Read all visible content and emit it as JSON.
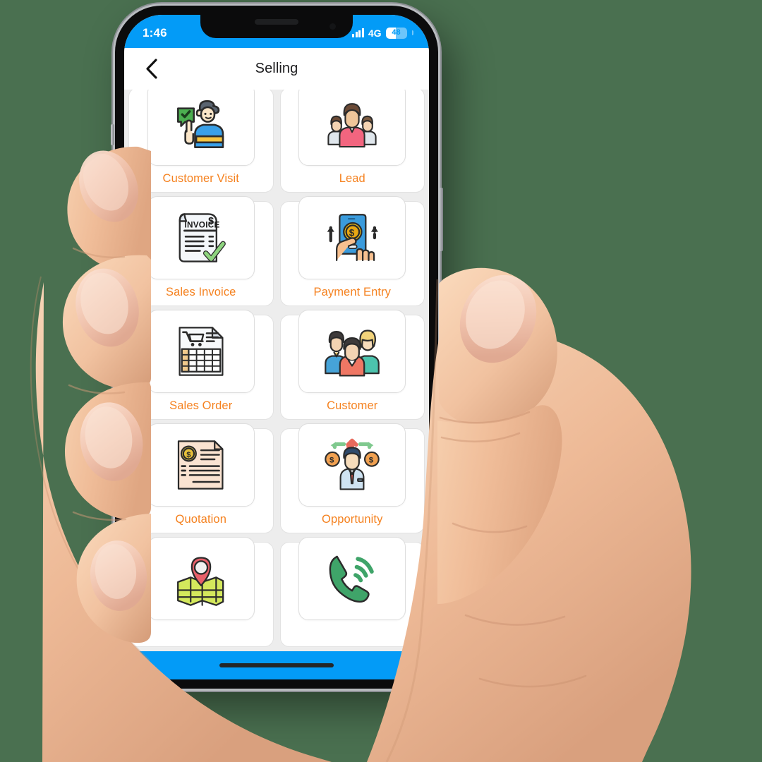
{
  "device": {
    "type": "smartphone",
    "orientation": "portrait"
  },
  "status_bar": {
    "time": "1:46",
    "network_type": "4G",
    "battery_level": "48",
    "battery_percent": 48,
    "signal_bars": 4,
    "background_color": "#039BF7",
    "text_color": "#FFFFFF"
  },
  "nav_bar": {
    "title": "Selling",
    "back_label": "Back",
    "background_color": "#FFFFFF",
    "title_color": "#1D1D1F"
  },
  "theme": {
    "accent_orange": "#F58220",
    "accent_blue": "#039BF7",
    "page_background": "#EDEDED",
    "card_background": "#FFFFFF",
    "canvas_background": "#4A7050"
  },
  "grid": {
    "columns": 2,
    "tiles": [
      {
        "label": "Customer Visit",
        "icon": "customer-visit-icon"
      },
      {
        "label": "Lead",
        "icon": "lead-group-icon"
      },
      {
        "label": "Sales Invoice",
        "icon": "sales-invoice-icon"
      },
      {
        "label": "Payment Entry",
        "icon": "payment-entry-icon"
      },
      {
        "label": "Sales Order",
        "icon": "sales-order-icon"
      },
      {
        "label": "Customer",
        "icon": "customer-group-icon"
      },
      {
        "label": "Quotation",
        "icon": "quotation-icon"
      },
      {
        "label": "Opportunity",
        "icon": "opportunity-icon"
      },
      {
        "label": "",
        "icon": "map-pin-icon"
      },
      {
        "label": "",
        "icon": "phone-call-icon"
      }
    ]
  },
  "home_bar": {
    "background_color": "#039BF7",
    "indicator_color": "#242628"
  }
}
